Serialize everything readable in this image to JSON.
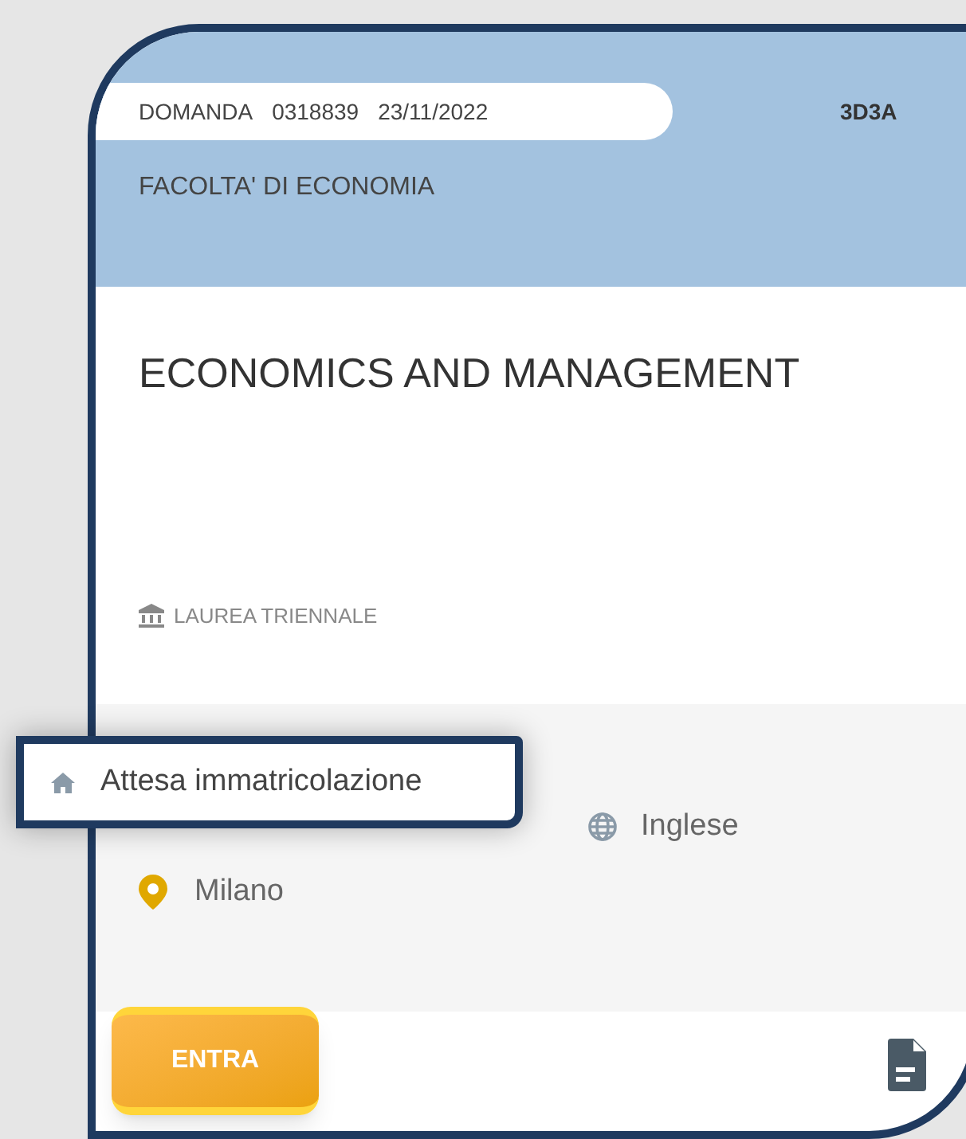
{
  "application": {
    "label": "DOMANDA",
    "number": "0318839",
    "date": "23/11/2022"
  },
  "code": "3D3A",
  "faculty": "FACOLTA' DI ECONOMIA",
  "course_title": "ECONOMICS AND MANAGEMENT",
  "degree_type": "LAUREA TRIENNALE",
  "status_popup": "Attesa immatricolazione",
  "language": "Inglese",
  "location": "Milano",
  "enter_button": "ENTRA"
}
